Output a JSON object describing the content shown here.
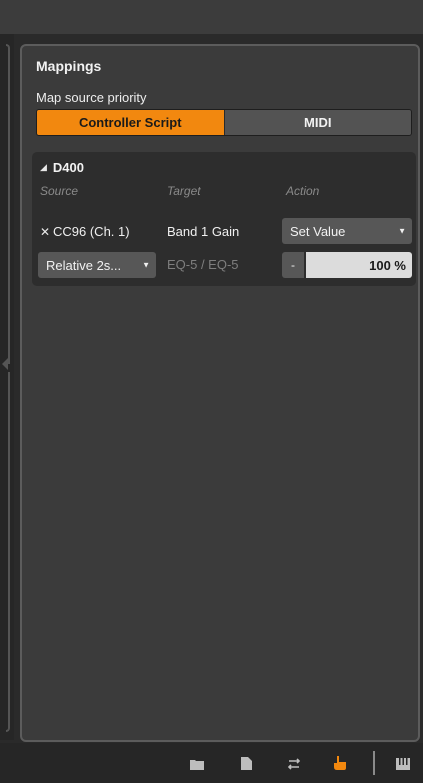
{
  "panel": {
    "title": "Mappings",
    "priority_label": "Map source priority",
    "priority_options": [
      "Controller Script",
      "MIDI"
    ],
    "priority_selected": "Controller Script"
  },
  "device": {
    "name": "D400",
    "columns": {
      "source": "Source",
      "target": "Target",
      "action": "Action"
    },
    "mapping": {
      "source": "CC96 (Ch. 1)",
      "target": "Band 1 Gain",
      "action": "Set Value",
      "mode": "Relative 2s...",
      "device_path": "EQ-5 / EQ-5",
      "minus_label": "-",
      "value": "100 %"
    }
  },
  "bottom_toolbar": {
    "icons": [
      "folder-icon",
      "document-icon",
      "arrows-icon",
      "hand-pointer-icon",
      "piano-icon"
    ],
    "active_icon": "hand-pointer-icon"
  },
  "colors": {
    "accent": "#f2880f",
    "panel_bg": "#3b3b3b",
    "card_bg": "#2d2d2d"
  }
}
